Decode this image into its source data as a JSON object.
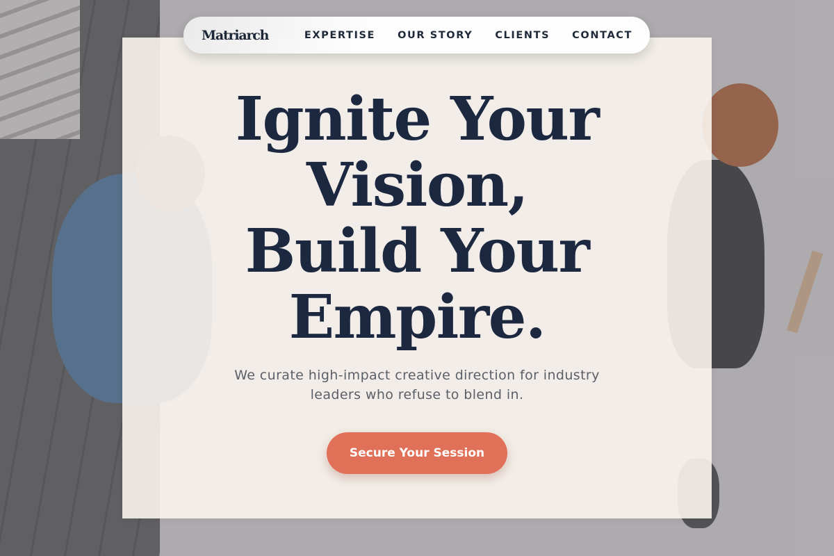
{
  "brand": {
    "logo_text": "Matriarch"
  },
  "nav": {
    "links": [
      {
        "label": "EXPERTISE"
      },
      {
        "label": "OUR STORY"
      },
      {
        "label": "CLIENTS"
      },
      {
        "label": "CONTACT"
      }
    ]
  },
  "hero": {
    "headline_lines": [
      "Ignite Your",
      "Vision,",
      "Build Your",
      "Empire."
    ],
    "subheadline": "We curate high-impact creative direction for industry leaders who refuse to blend in.",
    "cta_label": "Secure Your Session"
  },
  "colors": {
    "navy_text": "#1c2840",
    "accent_cta": "#e07058",
    "card_background": "#f9f4ee",
    "muted_text": "#5b5f68"
  }
}
